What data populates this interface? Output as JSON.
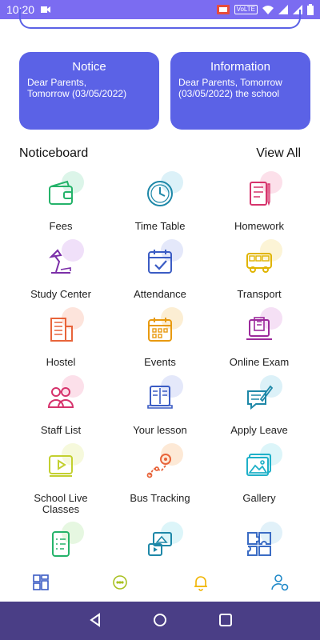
{
  "status_bar": {
    "time": "10:20",
    "network_badge": "VoLTE"
  },
  "cards": [
    {
      "title": "Notice",
      "text": "Dear Parents,\nTomorrow (03/05/2022)"
    },
    {
      "title": "Information",
      "text": "Dear Parents, Tomorrow\n(03/05/2022) the school"
    }
  ],
  "noticeboard": {
    "title": "Noticeboard",
    "view_all": "View All"
  },
  "modules": [
    {
      "label": "Fees",
      "icon": "wallet-icon",
      "color": "#25b36a",
      "blob": "#9be3c0"
    },
    {
      "label": "Time Table",
      "icon": "clock-icon",
      "color": "#1e88a8",
      "blob": "#9cd6ea"
    },
    {
      "label": "Homework",
      "icon": "notebook-icon",
      "color": "#d6336c",
      "blob": "#f7a6c4"
    },
    {
      "label": "Study Center",
      "icon": "desk-lamp-icon",
      "color": "#7b2fa8",
      "blob": "#d3a6ee"
    },
    {
      "label": "Attendance",
      "icon": "calendar-check-icon",
      "color": "#3b5cc4",
      "blob": "#b2bdf0"
    },
    {
      "label": "Transport",
      "icon": "bus-icon",
      "color": "#e0b400",
      "blob": "#f6e08a"
    },
    {
      "label": "Hostel",
      "icon": "building-icon",
      "color": "#e8643a",
      "blob": "#f8b39c"
    },
    {
      "label": "Events",
      "icon": "calendar-grid-icon",
      "color": "#e89a10",
      "blob": "#f7cf82"
    },
    {
      "label": "Online Exam",
      "icon": "laptop-exam-icon",
      "color": "#9c2a9c",
      "blob": "#e3a6e3"
    },
    {
      "label": "Staff List",
      "icon": "users-icon",
      "color": "#d6336c",
      "blob": "#f7a6c4"
    },
    {
      "label": "Your lesson",
      "icon": "open-book-icon",
      "color": "#3b5cc4",
      "blob": "#b2bdf0"
    },
    {
      "label": "Apply Leave",
      "icon": "edit-note-icon",
      "color": "#1e88a8",
      "blob": "#9cd6ea"
    },
    {
      "label": "School Live\nClasses",
      "icon": "video-icon",
      "color": "#c3d030",
      "blob": "#e6ef9c"
    },
    {
      "label": "Bus Tracking",
      "icon": "route-pin-icon",
      "color": "#e8643a",
      "blob": "#f8c08a"
    },
    {
      "label": "Gallery",
      "icon": "image-icon",
      "color": "#1eb0c8",
      "blob": "#9be3ee"
    },
    {
      "label": "",
      "icon": "checklist-phone-icon",
      "color": "#25b36a",
      "blob": "#b6e8a8"
    },
    {
      "label": "",
      "icon": "media-icon",
      "color": "#1e88a8",
      "blob": "#9be3ee"
    },
    {
      "label": "",
      "icon": "puzzle-icon",
      "color": "#3b6cc4",
      "blob": "#a8d8ee"
    }
  ],
  "bottom_nav": [
    {
      "icon": "dashboard-icon",
      "color": "#3b5cc4"
    },
    {
      "icon": "chat-icon",
      "color": "#a8c020"
    },
    {
      "icon": "bell-icon",
      "color": "#f0b400"
    },
    {
      "icon": "profile-settings-icon",
      "color": "#1e88c8"
    }
  ]
}
